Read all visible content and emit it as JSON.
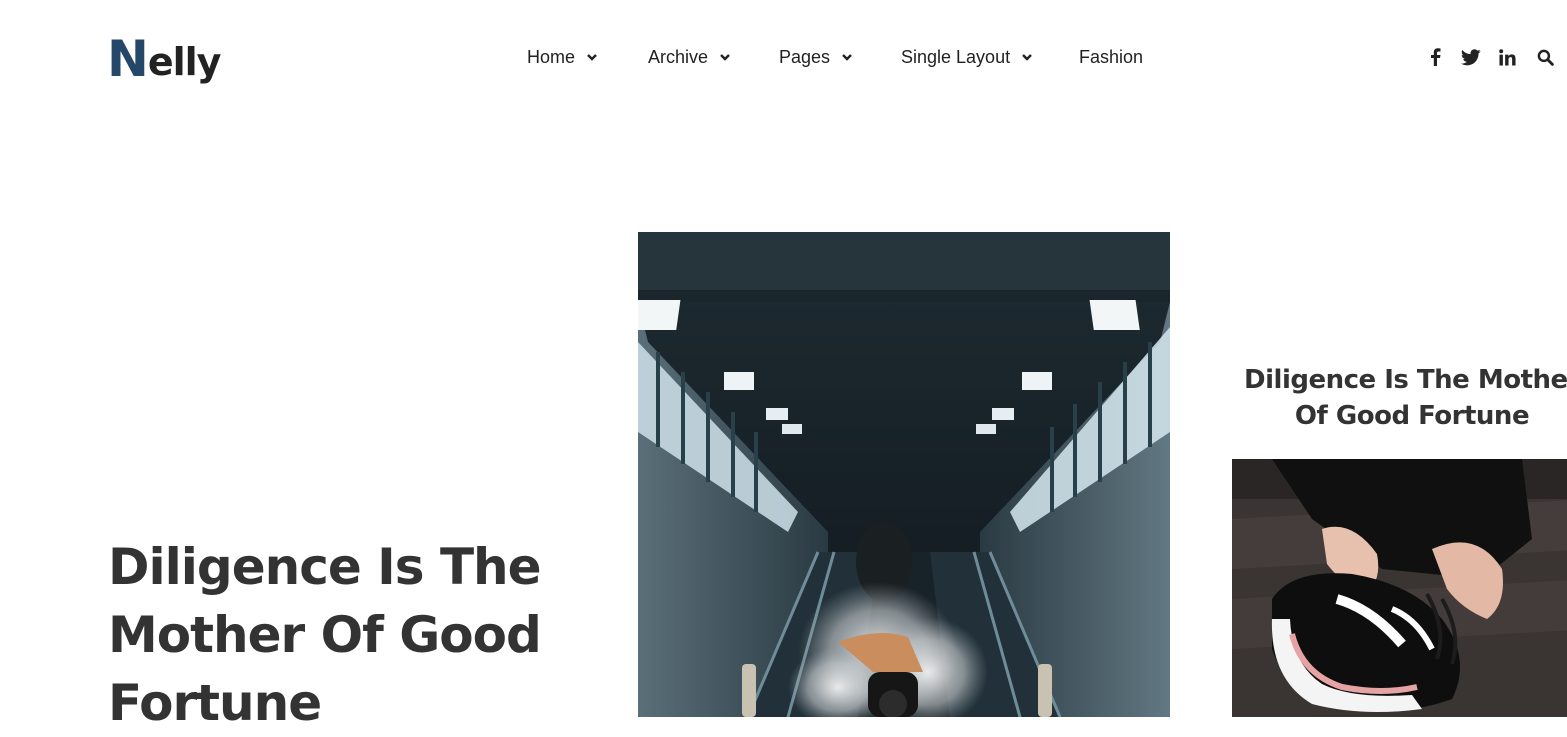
{
  "brand": {
    "logo_first": "N",
    "logo_rest": "elly",
    "colors": {
      "logo_n": "#24476a",
      "text": "#333333"
    }
  },
  "nav": {
    "items": [
      {
        "label": "Home",
        "has_dropdown": true
      },
      {
        "label": "Archive",
        "has_dropdown": true
      },
      {
        "label": "Pages",
        "has_dropdown": true
      },
      {
        "label": "Single Layout",
        "has_dropdown": true
      },
      {
        "label": "Fashion",
        "has_dropdown": false
      }
    ]
  },
  "social": {
    "icons": [
      "facebook-icon",
      "twitter-icon",
      "linkedin-icon",
      "search-icon"
    ]
  },
  "hero": {
    "title": "Diligence Is The Mother Of Good Fortune"
  },
  "side_post": {
    "title_line1": "Diligence Is The Mother",
    "title_line2": "Of Good Fortune"
  }
}
